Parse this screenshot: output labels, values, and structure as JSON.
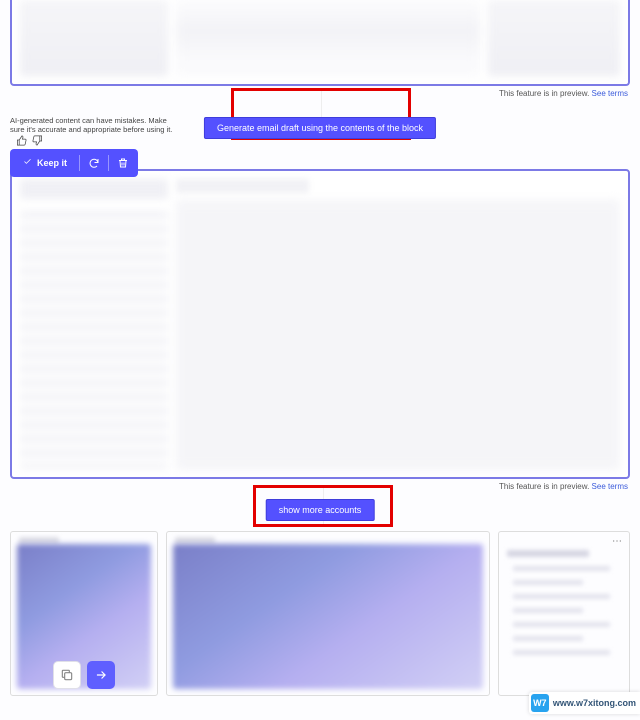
{
  "preview": {
    "text": "This feature is in preview.",
    "link": "See terms"
  },
  "cta": {
    "generate": "Generate email draft using the contents of the block",
    "show_more": "show more accounts"
  },
  "ai": {
    "disclaimer": "AI-generated content can have mistakes. Make sure it's accurate and appropriate before using it.",
    "keep": "Keep it"
  },
  "watermark": {
    "logo": "W7",
    "text": "www.w7xitong.com"
  }
}
